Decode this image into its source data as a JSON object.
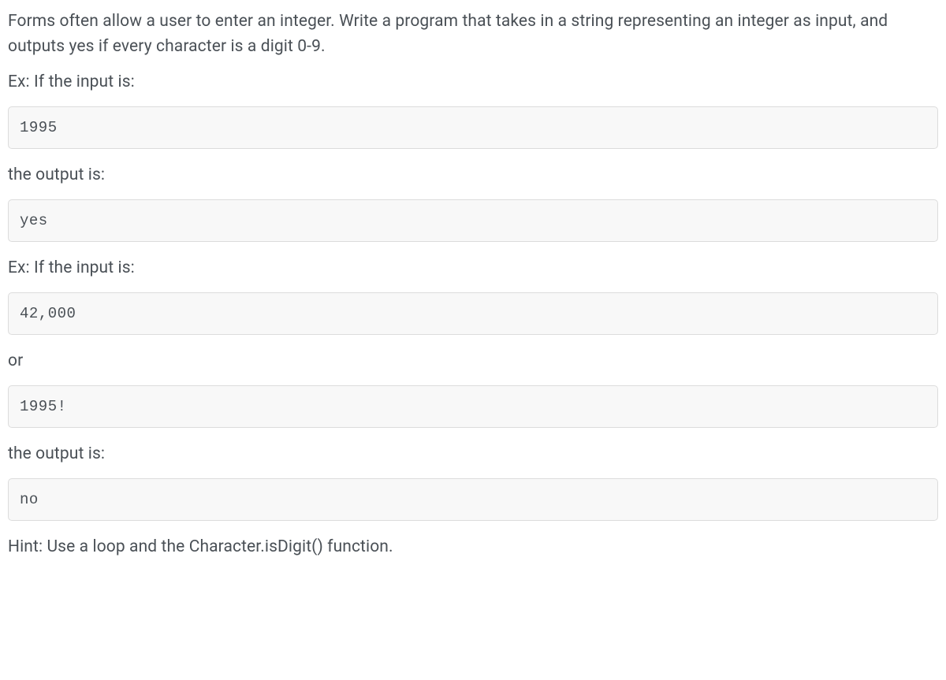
{
  "problem": {
    "description": "Forms often allow a user to enter an integer. Write a program that takes in a string representing an integer as input, and outputs yes if every character is a digit 0-9.",
    "example1": {
      "prompt": "Ex: If the input is:",
      "input": "1995",
      "outputLabel": "the output is:",
      "output": "yes"
    },
    "example2": {
      "prompt": "Ex: If the input is:",
      "input1": "42,000",
      "orLabel": "or",
      "input2": "1995!",
      "outputLabel": "the output is:",
      "output": "no"
    },
    "hint": "Hint: Use a loop and the Character.isDigit() function."
  }
}
